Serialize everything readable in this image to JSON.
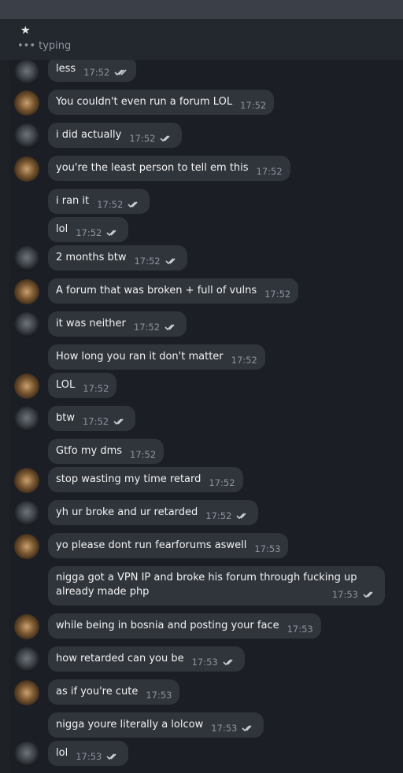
{
  "header": {
    "star_glyph": "★",
    "typing": "••• typing"
  },
  "colors": {
    "bubble": "#30353c",
    "background": "#1b1e24",
    "header": "#23272e",
    "check": "#c8ccd2"
  },
  "messages": [
    {
      "text": "less",
      "time": "17:52",
      "from": "a",
      "checks": true
    },
    {
      "text": "You couldn't even run a forum LOL",
      "time": "17:52",
      "from": "b",
      "checks": false
    },
    {
      "text": "i did actually",
      "time": "17:52",
      "from": "a",
      "checks": true
    },
    {
      "text": "you're the least person to tell em this",
      "time": "17:52",
      "from": "b",
      "checks": false
    },
    {
      "text": "i ran it",
      "time": "17:52",
      "from": "a",
      "checks": true
    },
    {
      "text": "lol",
      "time": "17:52",
      "from": "a",
      "checks": true
    },
    {
      "text": "2 months btw",
      "time": "17:52",
      "from": "a",
      "checks": true
    },
    {
      "text": "A forum that was broken + full of vulns",
      "time": "17:52",
      "from": "b",
      "checks": false
    },
    {
      "text": "it was neither",
      "time": "17:52",
      "from": "a",
      "checks": true
    },
    {
      "text": "How long you ran it don't matter",
      "time": "17:52",
      "from": "b",
      "checks": false
    },
    {
      "text": "LOL",
      "time": "17:52",
      "from": "b",
      "checks": false
    },
    {
      "text": "btw",
      "time": "17:52",
      "from": "a",
      "checks": true
    },
    {
      "text": "Gtfo my dms",
      "time": "17:52",
      "from": "b",
      "checks": false
    },
    {
      "text": "stop wasting my time retard",
      "time": "17:52",
      "from": "b",
      "checks": false
    },
    {
      "text": "yh ur broke and ur retarded",
      "time": "17:52",
      "from": "a",
      "checks": true
    },
    {
      "text": "yo please dont run fearforums aswell",
      "time": "17:53",
      "from": "b",
      "checks": false
    },
    {
      "text": "nigga got a VPN IP and broke his forum through fucking up already made php",
      "time": "17:53",
      "from": "a",
      "checks": true
    },
    {
      "text": "while being in bosnia and posting your face",
      "time": "17:53",
      "from": "b",
      "checks": false
    },
    {
      "text": "how retarded can you be",
      "time": "17:53",
      "from": "a",
      "checks": true
    },
    {
      "text": "as if you're cute",
      "time": "17:53",
      "from": "b",
      "checks": false
    },
    {
      "text": "nigga youre literally a lolcow",
      "time": "17:53",
      "from": "a",
      "checks": true
    },
    {
      "text": "lol",
      "time": "17:53",
      "from": "a",
      "checks": true
    }
  ]
}
